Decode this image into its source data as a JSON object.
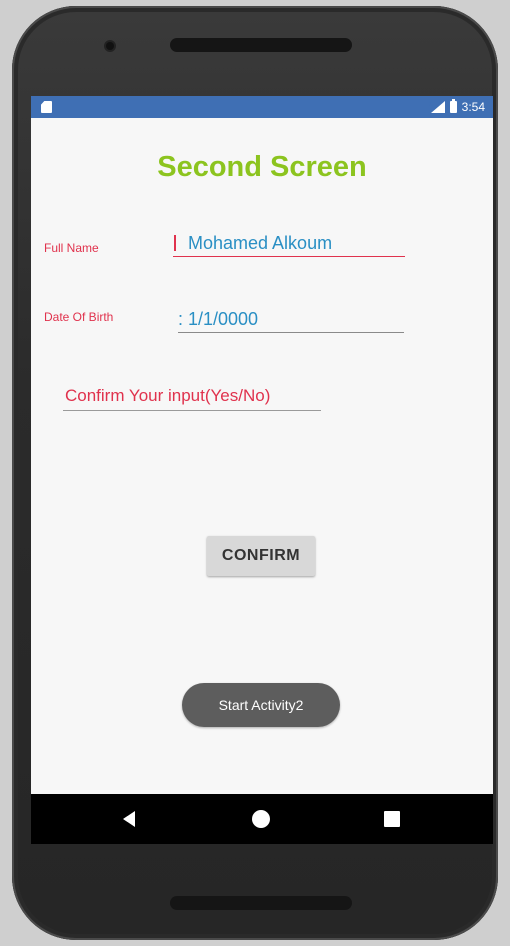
{
  "status_bar": {
    "time": "3:54",
    "icons": [
      "sd-card-icon",
      "signal-icon",
      "battery-icon"
    ]
  },
  "screen": {
    "title": "Second Screen",
    "fields": {
      "full_name": {
        "label": "Full Name",
        "value": "Mohamed Alkoum"
      },
      "date_of_birth": {
        "label": "Date Of Birth",
        "value": ": 1/1/0000"
      }
    },
    "confirm_input": {
      "placeholder": "Confirm Your input(Yes/No)"
    },
    "confirm_button_label": "CONFIRM",
    "start_activity_label": "Start Activity2"
  },
  "nav_bar": {
    "icons": [
      "back-icon",
      "home-icon",
      "recents-icon"
    ]
  },
  "colors": {
    "title": "#8cc41f",
    "accent_red": "#e0324d",
    "field_text": "#2a8fc4",
    "status_bar": "#3f6fb4"
  }
}
